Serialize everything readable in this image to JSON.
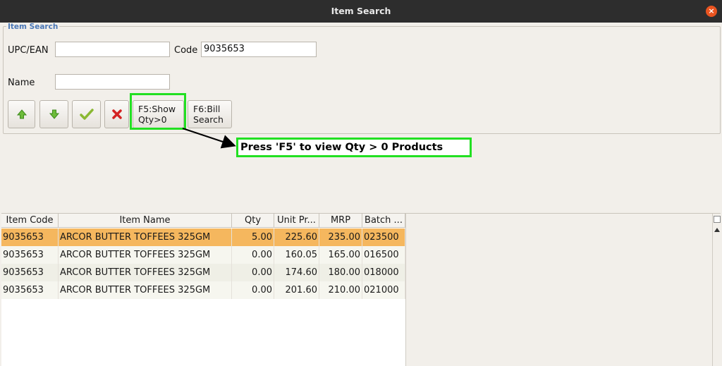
{
  "window": {
    "title": "Item Search",
    "close_glyph": "×"
  },
  "search_group": {
    "legend": "Item Search",
    "upc_label": "UPC/EAN",
    "upc_value": "",
    "code_label": "Code",
    "code_value": "9035653",
    "name_label": "Name",
    "name_value": ""
  },
  "buttons": {
    "up_icon": "arrow-up-icon",
    "down_icon": "arrow-down-icon",
    "ok_icon": "check-icon",
    "cancel_icon": "cross-icon",
    "f5_line1": "F5:Show",
    "f5_line2": "Qty>0",
    "f6_line1": "F6:Bill",
    "f6_line2": "Search"
  },
  "annotation": {
    "text": "Press 'F5' to view Qty > 0 Products"
  },
  "table": {
    "columns": [
      "Item Code",
      "Item Name",
      "Qty",
      "Unit Pr...",
      "MRP",
      "Batch ..."
    ],
    "rows": [
      {
        "code": "9035653",
        "name": "ARCOR BUTTER TOFFEES 325GM",
        "qty": "5.00",
        "unit_price": "225.60",
        "mrp": "235.00",
        "batch": "023500"
      },
      {
        "code": "9035653",
        "name": "ARCOR BUTTER TOFFEES 325GM",
        "qty": "0.00",
        "unit_price": "160.05",
        "mrp": "165.00",
        "batch": "016500"
      },
      {
        "code": "9035653",
        "name": "ARCOR BUTTER TOFFEES 325GM",
        "qty": "0.00",
        "unit_price": "174.60",
        "mrp": "180.00",
        "batch": "018000"
      },
      {
        "code": "9035653",
        "name": "ARCOR BUTTER TOFFEES 325GM",
        "qty": "0.00",
        "unit_price": "201.60",
        "mrp": "210.00",
        "batch": "021000"
      }
    ]
  },
  "colors": {
    "highlight": "#22e022",
    "selected_row": "#f5b75e",
    "legend": "#4a77b6",
    "close": "#e95420"
  }
}
